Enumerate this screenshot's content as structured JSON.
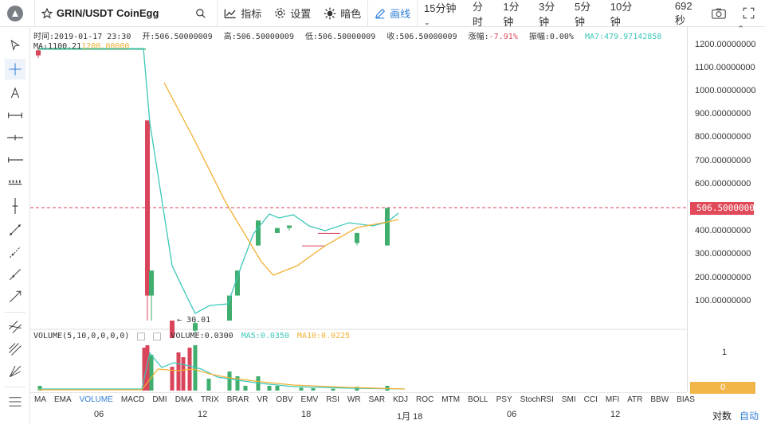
{
  "toolbar": {
    "symbol": "GRIN/USDT CoinEgg",
    "indicators_label": "指标",
    "settings_label": "设置",
    "dark_label": "暗色",
    "draw_label": "画线",
    "intervals": [
      "15分钟",
      "分时",
      "1分钟",
      "3分钟",
      "5分钟",
      "10分钟"
    ],
    "active_interval": "15分钟",
    "countdown": "692秒"
  },
  "legend": {
    "time": "时间:2019-01-17 23:30",
    "open": "开:506.50000009",
    "high": "高:506.50000009",
    "low": "低:506.50000009",
    "close": "收:506.50000009",
    "change": "涨幅:-7.91%",
    "amplitude": "振幅:0.00%",
    "ma7": "MA7:479.97142858",
    "overlap_label": "MA₁1100.21",
    "overlap_label2": "1200.00000"
  },
  "volume_legend": {
    "title": "VOLUME(5,10,0,0,0,0)",
    "volume": "VOLUME:0.0300",
    "ma5": "MA5:0.0350",
    "ma10": "MA10:0.0225"
  },
  "price_axis": [
    "1200.00000000",
    "1100.00000000",
    "1000.00000000",
    "900.00000000",
    "800.00000000",
    "700.00000000",
    "600.00000000",
    "506.50000009",
    "400.00000000",
    "300.00000000",
    "200.00000000",
    "100.00000000"
  ],
  "last_price": "506.50000009",
  "min_label": "30.01",
  "volume_axis": {
    "one": "1",
    "zero": "0"
  },
  "indicator_tabs": [
    "MA",
    "EMA",
    "VOLUME",
    "MACD",
    "DMI",
    "DMA",
    "TRIX",
    "BRAR",
    "VR",
    "OBV",
    "EMV",
    "RSI",
    "WR",
    "SAR",
    "KDJ",
    "ROC",
    "MTM",
    "BOLL",
    "PSY",
    "StochRSI",
    "SMI",
    "CCI",
    "MFI",
    "ATR",
    "BBW",
    "BIAS"
  ],
  "active_indicator": "VOLUME",
  "time_labels": [
    "06",
    "12",
    "18",
    "1月 18",
    "06",
    "12"
  ],
  "scale_mode": "对数",
  "auto_mode": "自动",
  "colors": {
    "up": "#3fae6f",
    "down": "#d9455a",
    "ma7": "#3cc7b8",
    "ma_slow": "#f2b133",
    "accent": "#2f7fd8"
  },
  "chart_data": {
    "type": "candlestick",
    "candles": [
      {
        "t": 1,
        "open": 1180,
        "close": 1160,
        "high": 1190,
        "low": 1150
      },
      {
        "t": 2,
        "open": 900,
        "close": 200,
        "high": 900,
        "low": 100
      },
      {
        "t": 3,
        "open": 200,
        "close": 300,
        "high": 300,
        "low": 100
      },
      {
        "t": 4,
        "open": 100,
        "close": 30,
        "high": 100,
        "low": 30
      },
      {
        "t": 5,
        "open": 60,
        "close": 90,
        "high": 100,
        "low": 50
      },
      {
        "t": 6,
        "open": 100,
        "close": 200,
        "high": 200,
        "low": 100
      },
      {
        "t": 7,
        "open": 200,
        "close": 300,
        "high": 300,
        "low": 200
      },
      {
        "t": 8,
        "open": 400,
        "close": 500,
        "high": 500,
        "low": 400
      },
      {
        "t": 9,
        "open": 450,
        "close": 470,
        "high": 470,
        "low": 450
      },
      {
        "t": 10,
        "open": 470,
        "close": 480,
        "high": 480,
        "low": 460
      },
      {
        "t": 11,
        "open": 400,
        "close": 400,
        "high": 400,
        "low": 400
      },
      {
        "t": 12,
        "open": 450,
        "close": 450,
        "high": 450,
        "low": 450
      },
      {
        "t": 13,
        "open": 410,
        "close": 450,
        "high": 450,
        "low": 400
      },
      {
        "t": 14,
        "open": 400,
        "close": 550,
        "high": 550,
        "low": 400
      }
    ],
    "ylim": [
      0,
      1250
    ],
    "log_scale": true
  }
}
